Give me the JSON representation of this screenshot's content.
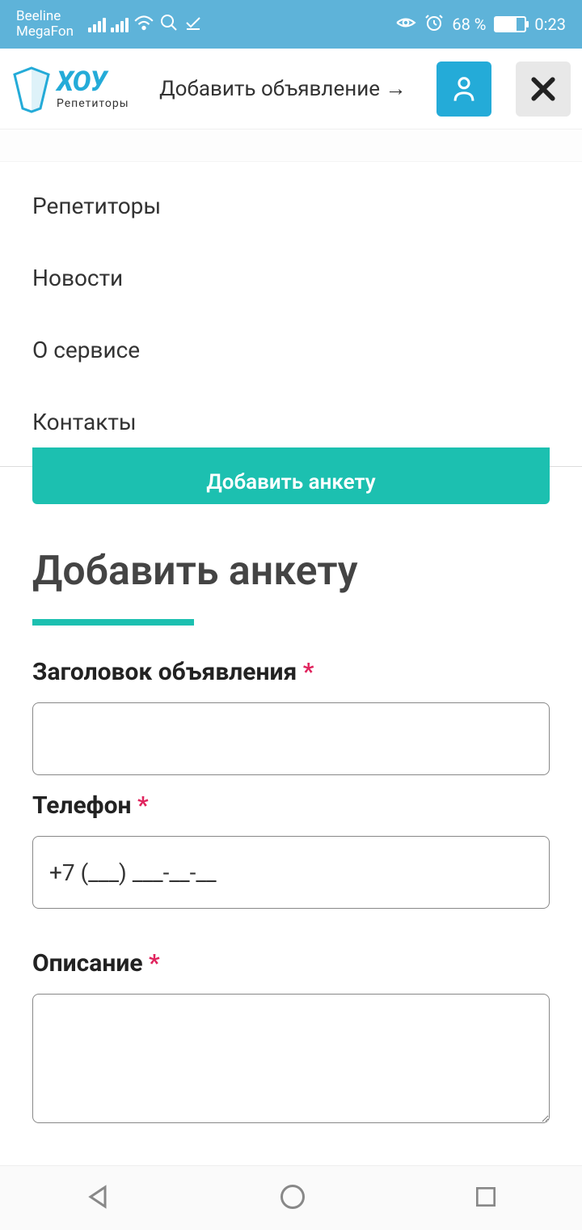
{
  "statusbar": {
    "carrier1": "Beeline",
    "carrier2": "MegaFon",
    "battery_pct": "68 %",
    "time": "0:23"
  },
  "header": {
    "brand": "ХОУ",
    "sub": "Репетиторы",
    "add_link": "Добавить объявление →"
  },
  "nav": {
    "items": [
      {
        "label": "Репетиторы"
      },
      {
        "label": "Новости"
      },
      {
        "label": "О сервисе"
      },
      {
        "label": "Контакты"
      }
    ]
  },
  "banner": {
    "label": "Добавить анкету"
  },
  "page": {
    "title": "Добавить анкету"
  },
  "form": {
    "title_field": {
      "label": "Заголовок объявления",
      "value": ""
    },
    "phone_field": {
      "label": "Телефон",
      "value": "+7 (___) ___-__-__"
    },
    "desc_field": {
      "label": "Описание",
      "value": ""
    }
  }
}
